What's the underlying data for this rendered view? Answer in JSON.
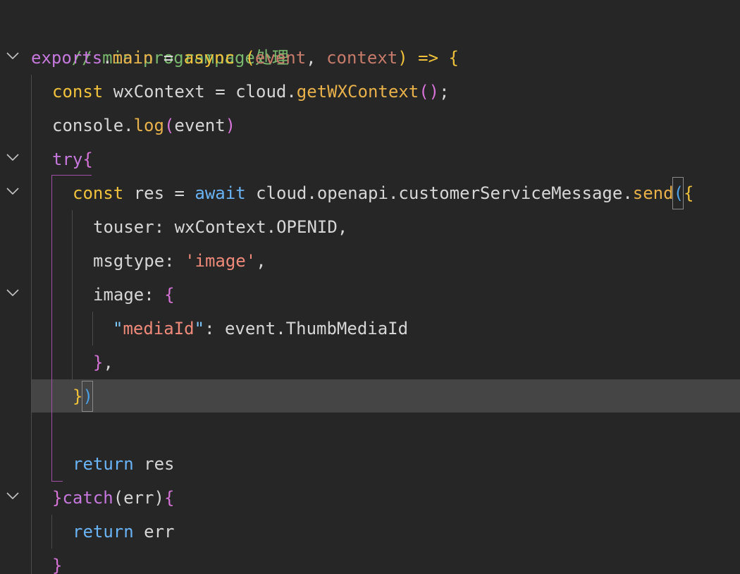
{
  "lines": [
    {
      "comment": "// miniprogrampage处理"
    },
    {
      "t1": "exports",
      "t2": ".",
      "t3": "main",
      "t4": " = ",
      "t5": "async",
      "t6": " (",
      "t7": "event",
      "t8": ", ",
      "t9": "context",
      "t10": ") ",
      "t11": "=>",
      "t12": " ",
      "t13": "{"
    },
    {
      "t1": "const",
      "t2": " wxContext = ",
      "t3": "cloud",
      "t4": ".",
      "t5": "getWXContext",
      "t6": "()",
      "t7": ";"
    },
    {
      "t1": "console",
      "t2": ".",
      "t3": "log",
      "t4": "(",
      "t5": "event",
      "t6": ")"
    },
    {
      "t1": "try",
      "t2": "{"
    },
    {
      "t1": "const",
      "t2": " res = ",
      "t3": "await",
      "t4": " cloud",
      "t5": ".",
      "t6": "openapi",
      "t7": ".",
      "t8": "customerServiceMessage",
      "t9": ".",
      "t10": "send",
      "t11": "(",
      "t12": "{"
    },
    {
      "t1": "touser",
      "t2": ": wxContext",
      "t3": ".",
      "t4": "OPENID",
      "t5": ","
    },
    {
      "t1": "msgtype",
      "t2": ": ",
      "t3": "'image'",
      "t4": ","
    },
    {
      "t1": "image",
      "t2": ": ",
      "t3": "{"
    },
    {
      "t1": "\"",
      "t2": "mediaId",
      "t3": "\"",
      "t4": ": event",
      "t5": ".",
      "t6": "ThumbMediaId"
    },
    {
      "t1": "}",
      "t2": ","
    },
    {
      "t1": "}",
      "t2": ")"
    },
    {},
    {
      "t1": "return",
      "t2": " res"
    },
    {
      "t1": "}",
      "t2": "catch",
      "t3": "(err)",
      "t4": "{"
    },
    {
      "t1": "return",
      "t2": " err"
    },
    {
      "t1": "}"
    }
  ],
  "colors": {
    "background": "#262626",
    "current_line": "#454545",
    "comment": "#79b76d",
    "keyword": "#c678dd",
    "function": "#e9b14a",
    "string": "#ef8a7a"
  }
}
